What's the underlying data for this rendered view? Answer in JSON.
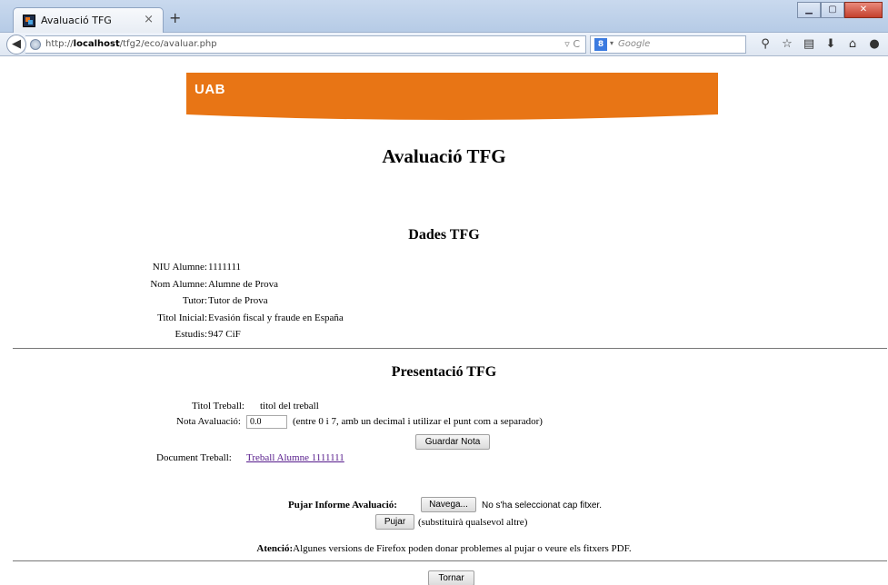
{
  "browser": {
    "tab_title": "Avaluació TFG",
    "tab_close": "×",
    "new_tab": "+",
    "url_prefix": "http://",
    "url_host": "localhost",
    "url_path": "/tfg2/eco/avaluar.php",
    "url_icons": "▿ C",
    "search_engine": "8",
    "search_placeholder": "Google",
    "icons": [
      "search-icon",
      "star-icon",
      "bookmarks-icon",
      "download-icon",
      "home-icon",
      "chat-icon",
      "menu-icon"
    ]
  },
  "banner": {
    "logo": "UAB",
    "color": "#e87515"
  },
  "page_title": "Avaluació TFG",
  "dades": {
    "title": "Dades TFG",
    "rows": [
      {
        "label": "NIU Alumne:",
        "value": "1111111"
      },
      {
        "label": "Nom Alumne:",
        "value": "Alumne de Prova"
      },
      {
        "label": "Tutor:",
        "value": "Tutor de Prova"
      },
      {
        "label": "Titol Inicial:",
        "value": "Evasión fiscal y fraude en España"
      },
      {
        "label": "Estudis:",
        "value": "947 CiF"
      }
    ]
  },
  "presentacio": {
    "title": "Presentació TFG",
    "titol_label": "Titol Treball:",
    "titol_value": "titol del treball",
    "nota_label": "Nota Avaluació:",
    "nota_value": "0.0",
    "nota_hint": "(entre 0 i 7, amb un decimal i utilizar el punt com a separador)",
    "guardar_label": "Guardar Nota",
    "document_label": "Document Treball:",
    "document_link": "Treball Alumne 1111111",
    "pujar_informe_label": "Pujar Informe Avaluació:",
    "navega_label": "Navega...",
    "no_file_text": "No s'ha seleccionat cap fitxer.",
    "pujar_label": "Pujar",
    "pujar_hint": "(substituirà qualsevol altre)",
    "atencio_bold": "Atenció:",
    "atencio_text": "Algunes versions de Firefox poden donar problemes al pujar o veure els fitxers PDF."
  },
  "tornar_label": "Tornar"
}
